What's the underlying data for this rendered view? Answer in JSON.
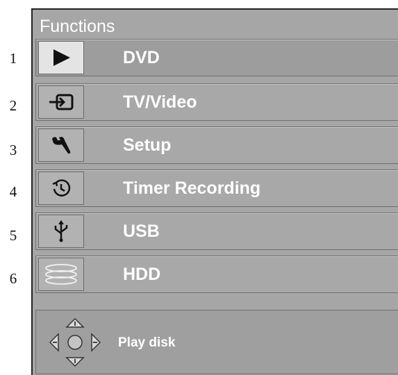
{
  "menu": {
    "title": "Functions",
    "items": [
      {
        "num": "1",
        "label": "DVD",
        "icon": "play-icon"
      },
      {
        "num": "2",
        "label": "TV/Video",
        "icon": "input-icon"
      },
      {
        "num": "3",
        "label": "Setup",
        "icon": "wrench-icon"
      },
      {
        "num": "4",
        "label": "Timer Recording",
        "icon": "timer-icon"
      },
      {
        "num": "5",
        "label": "USB",
        "icon": "usb-icon"
      },
      {
        "num": "6",
        "label": "HDD",
        "icon": "hdd-icon"
      }
    ],
    "hint": "Play disk"
  }
}
